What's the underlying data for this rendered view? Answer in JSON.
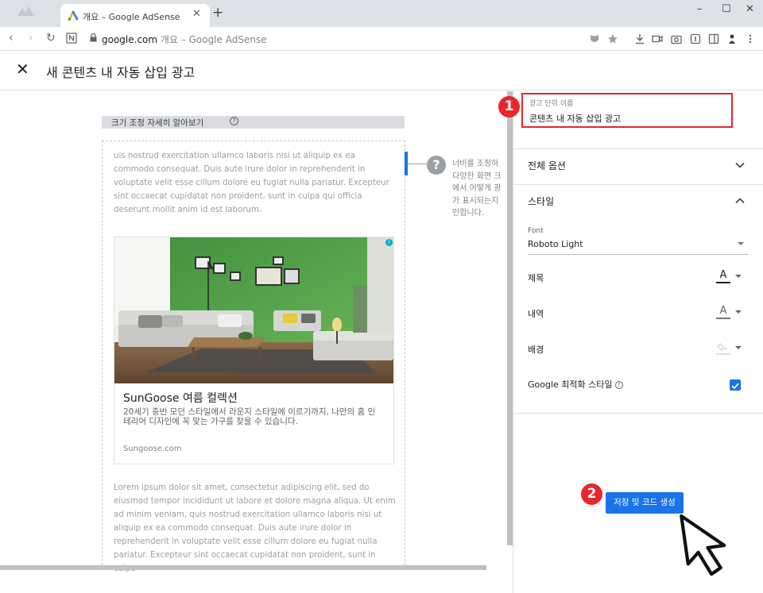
{
  "browser": {
    "tab_title": "개요 – Google AdSense",
    "tab_close": "✕",
    "new_tab": "+",
    "window_buttons": {
      "minimize": "–",
      "maximize": "☐",
      "close": "✕"
    },
    "url_host": "google.com",
    "url_rest": " 개요 – Google AdSense",
    "toolbar_icons": [
      "shield-icon",
      "star-icon",
      "download-icon",
      "video-icon",
      "camera-icon",
      "reader-icon",
      "sidebar-icon",
      "profile-icon",
      "more-icon"
    ]
  },
  "header": {
    "close_label": "✕",
    "title": "새 콘텐츠 내 자동 삽입 광고"
  },
  "preview": {
    "resize_label": "크기 조정 자세히 알아보기",
    "help_mark": "?",
    "lorem_top": "uis nostrud exercitation ullamco laboris nisi ut aliquip ex ea\ncommodo consequat. Duis aute irure dolor in reprehenderit in\nvoluptate velit esse cillum dolore eu fugiat nulla pariatur. Excepteur\nsint occaecat cupidatat non proident, sunt in culpa qui officia\ndeserunt mollit anim id est laborum.",
    "lorem_bottom": "Lorem ipsum dolor sit amet, consectetur adipiscing elit, sed do\neiusmod tempor incididunt ut labore et dolore magna aliqua. Ut enim\nad minim veniam, quis nostrud exercitation ullamco laboris nisi ut\naliquip ex ea commodo consequat. Duis aute irure dolor in\nreprehenderit in voluptate velit esse cillum dolore eu fugiat nulla\npariatur. Excepteur sint occaecat cupidatat non proident, sunt in culpa",
    "ad": {
      "choice_mark": "i",
      "headline": "SunGoose 여름 컬렉션",
      "description": "20세기 중반 모던 스타일에서 라운지 스타일에 이르기까지, 나만의 홈 인테리어 디자인에 꼭 맞는 가구를 찾을 수 있습니다.",
      "domain": "Sungoose.com"
    },
    "hint_mark": "?",
    "hint_text": "너비를 조정하\n다양한 화면 크\n에서 어떻게 광\n가 표시되는지\n인합니다."
  },
  "panel": {
    "ad_unit_name_label": "광고 단위 이름",
    "ad_unit_name_value": "콘텐츠 내 자동 삽입 광고",
    "all_options_title": "전체 옵션",
    "style_title": "스타일",
    "font_label": "Font",
    "font_value": "Roboto Light",
    "rows": {
      "title": "제목",
      "description": "내역",
      "background": "배경",
      "google_optimized": "Google 최적화 스타일"
    },
    "glyph_a": "A",
    "help_mark": "?",
    "colors": {
      "title_color": "#202124",
      "description_color": "#757575",
      "background_color": "#e0e0e0",
      "accent": "#1a73e8"
    },
    "optimized_checked": true
  },
  "actions": {
    "save_label": "저장 및 코드 생성"
  },
  "markers": {
    "one": "1",
    "two": "2"
  }
}
